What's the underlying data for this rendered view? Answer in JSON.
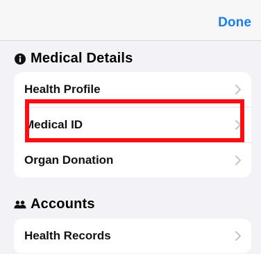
{
  "nav": {
    "done_label": "Done"
  },
  "sections": {
    "medical": {
      "title": "Medical Details",
      "items": [
        "Health Profile",
        "Medical ID",
        "Organ Donation"
      ]
    },
    "accounts": {
      "title": "Accounts",
      "items": [
        "Health Records"
      ]
    }
  },
  "icons": {
    "medical": "info-circle-icon",
    "accounts": "people-icon",
    "row": "chevron-right-icon"
  },
  "colors": {
    "accent": "#1a7cf3",
    "highlight": "#ff0d12",
    "background": "#f2f2f7"
  }
}
